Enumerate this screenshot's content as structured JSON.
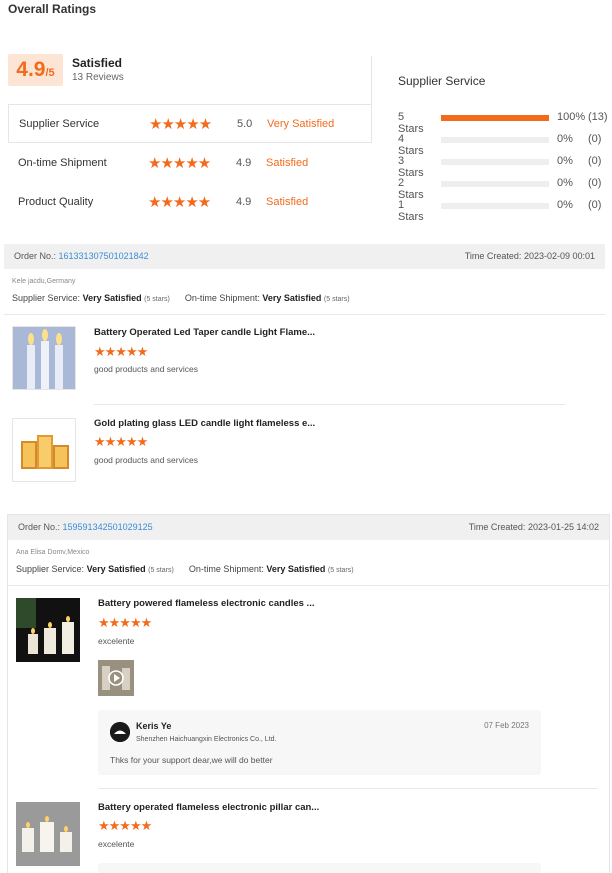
{
  "title": "Overall Ratings",
  "overall": {
    "score": "4.9",
    "out_of": "/5",
    "label": "Satisfied",
    "reviews": "13 Reviews"
  },
  "categories": [
    {
      "name": "Supplier Service",
      "stars": "★★★★★",
      "score": "5.0",
      "text": "Very Satisfied"
    },
    {
      "name": "On-time Shipment",
      "stars": "★★★★★",
      "score": "4.9",
      "text": "Satisfied"
    },
    {
      "name": "Product Quality",
      "stars": "★★★★★",
      "score": "4.9",
      "text": "Satisfied"
    }
  ],
  "distribution": {
    "title": "Supplier Service",
    "rows": [
      {
        "label": "5 Stars",
        "fraction": 1.0,
        "pct": "100%",
        "count": "(13)"
      },
      {
        "label": "4 Stars",
        "fraction": 0,
        "pct": "0%",
        "count": "(0)"
      },
      {
        "label": "3 Stars",
        "fraction": 0,
        "pct": "0%",
        "count": "(0)"
      },
      {
        "label": "2 Stars",
        "fraction": 0,
        "pct": "0%",
        "count": "(0)"
      },
      {
        "label": "1 Stars",
        "fraction": 0,
        "pct": "0%",
        "count": "(0)"
      }
    ]
  },
  "orders": [
    {
      "order_label": "Order No.:",
      "order_no": "161331307501021842",
      "time_label": "Time Created:",
      "time": "2023-02-09 00:01",
      "buyer": "Kele jacdu,Germany",
      "supplier_label": "Supplier Service:",
      "supplier_value": "Very Satisfied",
      "supplier_stars": "(5 stars)",
      "shipment_label": "On-time Shipment:",
      "shipment_value": "Very Satisfied",
      "shipment_stars": "(5 stars)",
      "products": [
        {
          "title": "Battery Operated Led Taper candle Light Flame...",
          "stars": "★★★★★",
          "comment": "good products and services"
        },
        {
          "title": "Gold plating glass LED candle light flameless e...",
          "stars": "★★★★★",
          "comment": "good products and services"
        }
      ]
    },
    {
      "order_label": "Order No.:",
      "order_no": "159591342501029125",
      "time_label": "Time Created:",
      "time": "2023-01-25 14:02",
      "buyer": "Ana Elisa Domv,Mexico",
      "supplier_label": "Supplier Service:",
      "supplier_value": "Very Satisfied",
      "supplier_stars": "(5 stars)",
      "shipment_label": "On-time Shipment:",
      "shipment_value": "Very Satisfied",
      "shipment_stars": "(5 stars)",
      "products": [
        {
          "title": "Battery powered flameless electronic candles ...",
          "stars": "★★★★★",
          "comment": "excelente"
        },
        {
          "title": "Battery operated flameless electronic pillar can...",
          "stars": "★★★★★",
          "comment": "excelente"
        }
      ],
      "reply": {
        "name": "Keris Ye",
        "company": "Shenzhen Haichuangxin Electronics Co., Ltd.",
        "date": "07 Feb 2023",
        "text": "Thks for your support dear,we will do better"
      }
    }
  ],
  "colors": {
    "accent": "#f26b1d",
    "link": "#3a8cd9"
  },
  "icons": {
    "star": "star-icon",
    "play": "play-icon"
  }
}
